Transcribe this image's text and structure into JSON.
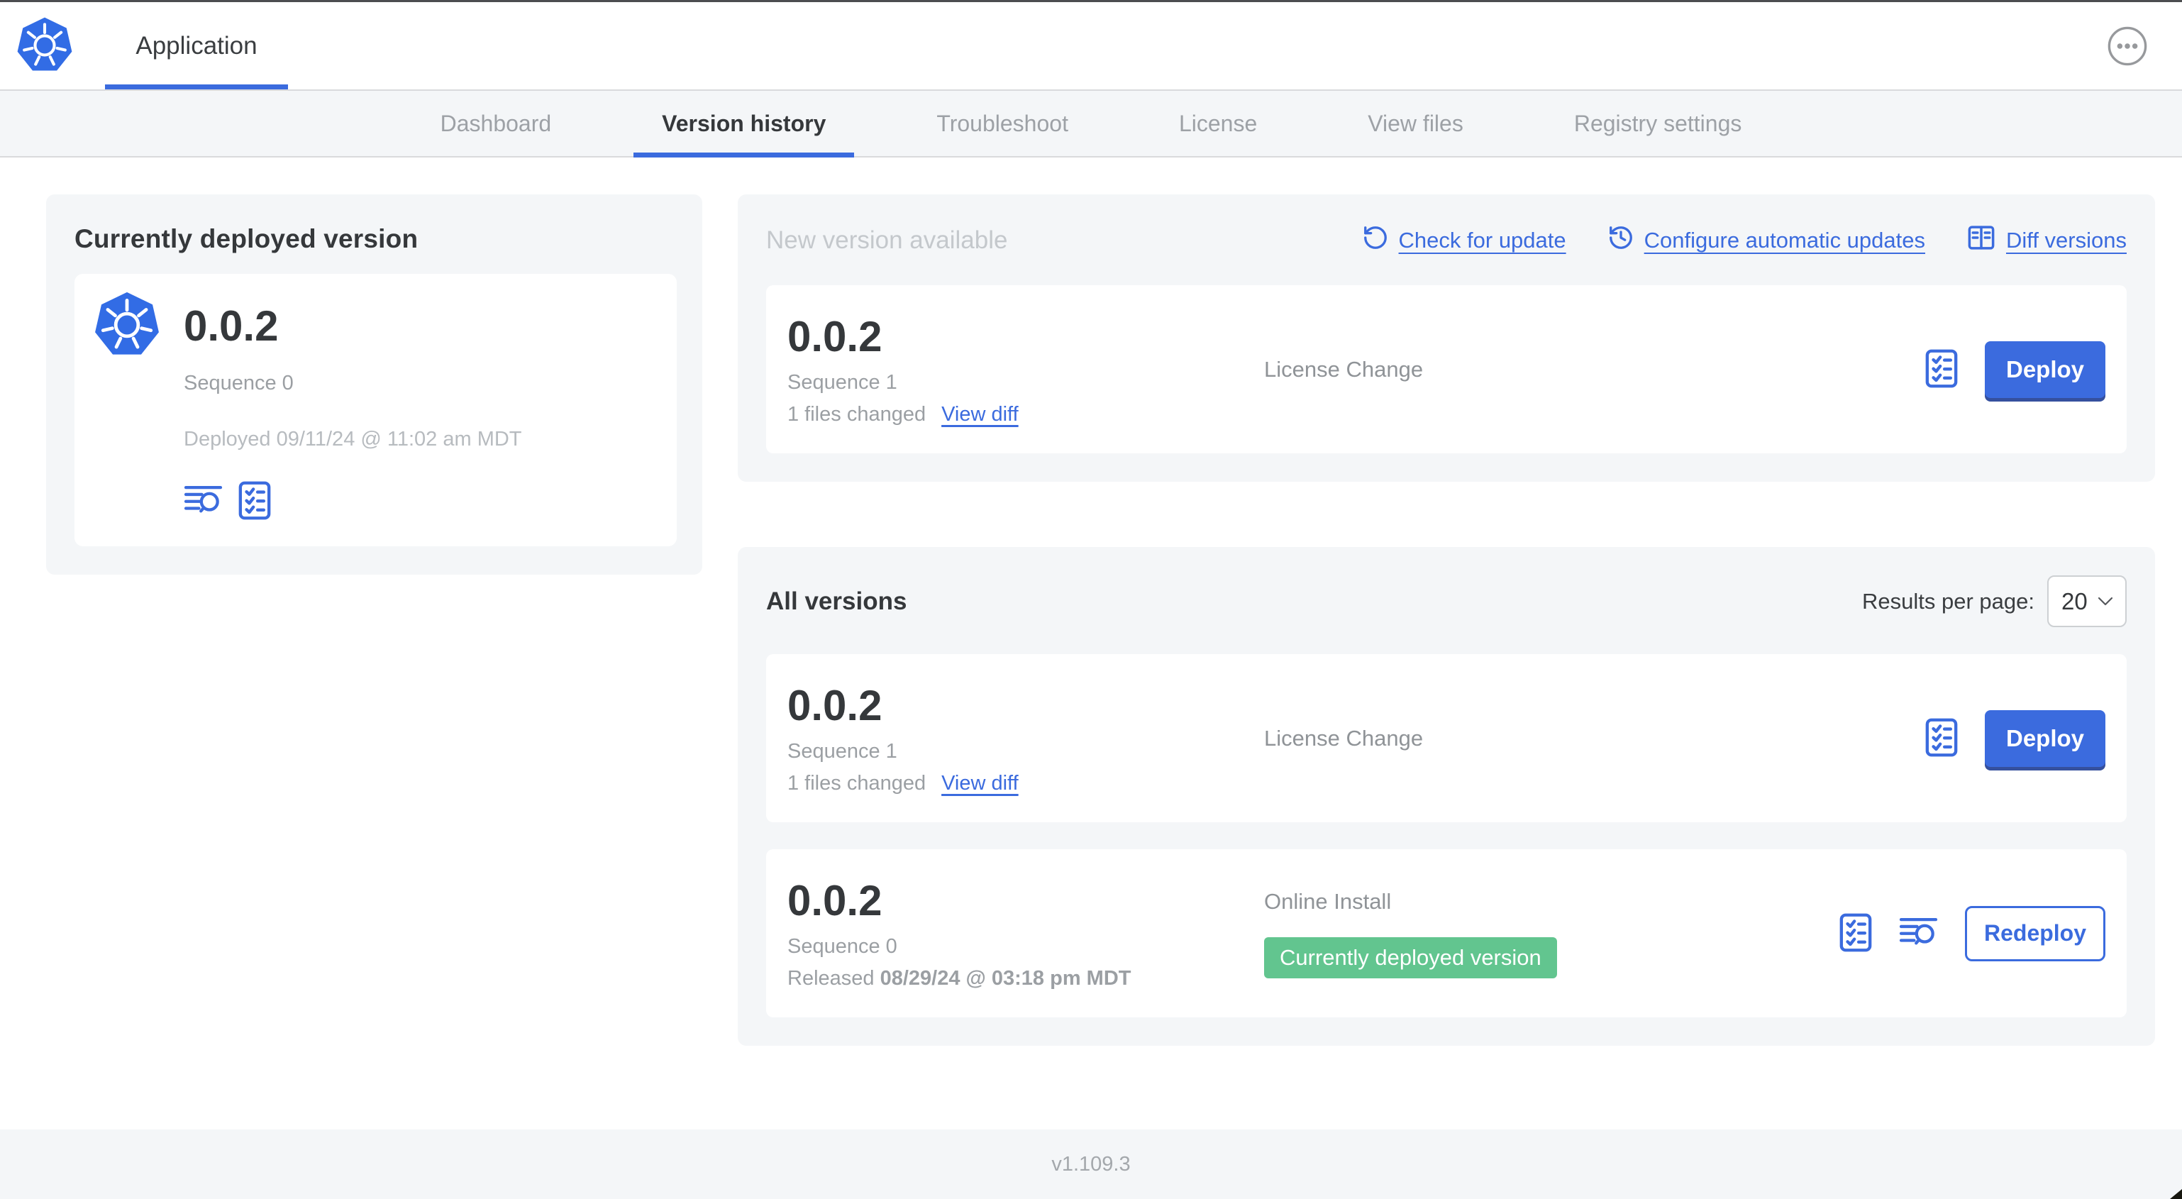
{
  "header": {
    "app_name": "Application",
    "menu_icon": "ellipsis-menu-icon"
  },
  "nav": {
    "active_tab": "Version history",
    "tabs": [
      {
        "label": "Dashboard"
      },
      {
        "label": "Version history"
      },
      {
        "label": "Troubleshoot"
      },
      {
        "label": "License"
      },
      {
        "label": "View files"
      },
      {
        "label": "Registry settings"
      }
    ]
  },
  "current_deployed": {
    "title": "Currently deployed version",
    "version": "0.0.2",
    "sequence": "Sequence 0",
    "deployed": "Deployed 09/11/24 @ 11:02 am MDT",
    "icons": [
      "logs-icon",
      "checklist-icon"
    ]
  },
  "new_version": {
    "title": "New version available",
    "actions": [
      {
        "label": "Check for update",
        "icon": "refresh-icon"
      },
      {
        "label": "Configure automatic updates",
        "icon": "clock-refresh-icon"
      },
      {
        "label": "Diff versions",
        "icon": "diff-icon"
      }
    ],
    "card": {
      "version": "0.0.2",
      "sequence": "Sequence 1",
      "files_changed": "1 files changed",
      "view_diff_label": "View diff",
      "change_type": "License Change",
      "action_label": "Deploy",
      "icons": [
        "checklist-icon"
      ]
    }
  },
  "all_versions": {
    "title": "All versions",
    "results_per_page_label": "Results per page:",
    "results_per_page_value": "20",
    "rows": [
      {
        "version": "0.0.2",
        "sequence": "Sequence 1",
        "files_changed": "1 files changed",
        "view_diff_label": "View diff",
        "change_type": "License Change",
        "action_label": "Deploy",
        "icons": [
          "checklist-icon"
        ]
      },
      {
        "version": "0.0.2",
        "sequence": "Sequence 0",
        "released_prefix": "Released ",
        "released_date": "08/29/24 @ 03:18 pm MDT",
        "change_type": "Online Install",
        "badge": "Currently deployed version",
        "action_label": "Redeploy",
        "icons": [
          "checklist-icon",
          "logs-icon"
        ]
      }
    ]
  },
  "footer": {
    "version": "v1.109.3"
  },
  "colors": {
    "accent_blue": "#3b6bde",
    "kubernetes_blue": "#326ce5",
    "badge_green": "#62c58f",
    "panel_gray": "#f4f6f8",
    "muted_heading": "#c4c8cc",
    "text_dark": "#35383b",
    "text_gray": "#9b9fa3"
  }
}
